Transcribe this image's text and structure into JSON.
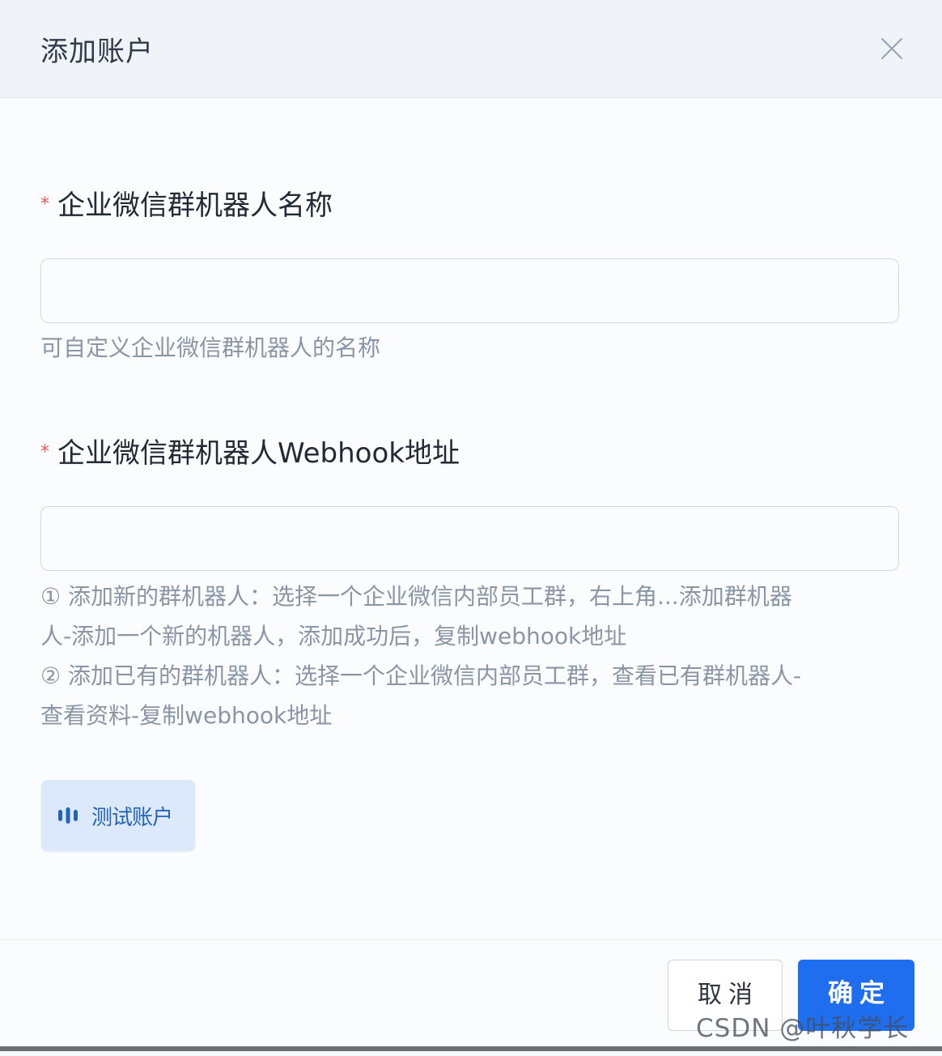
{
  "dialog": {
    "title": "添加账户",
    "close_icon": "close-icon"
  },
  "fields": [
    {
      "required_mark": "*",
      "label": "企业微信群机器人名称",
      "value": "",
      "placeholder": "",
      "hint": "可自定义企业微信群机器人的名称"
    },
    {
      "required_mark": "*",
      "label": "企业微信群机器人Webhook地址",
      "value": "",
      "placeholder": "",
      "help_lines": [
        "① 添加新的群机器人：选择一个企业微信内部员工群，右上角...添加群机器",
        "人-添加一个新的机器人，添加成功后，复制webhook地址",
        "② 添加已有的群机器人：选择一个企业微信内部员工群，查看已有群机器人-",
        "查看资料-复制webhook地址"
      ]
    }
  ],
  "test_button": {
    "label": "测试账户",
    "icon": "signal-bars-icon"
  },
  "footer": {
    "cancel_label": "取消",
    "confirm_label": "确定"
  },
  "watermark": "CSDN @叶秋学长",
  "colors": {
    "primary": "#1f6ef0",
    "required": "#f0584d",
    "hint_text": "#8a95a5",
    "test_button_bg": "#dbe9fa"
  }
}
